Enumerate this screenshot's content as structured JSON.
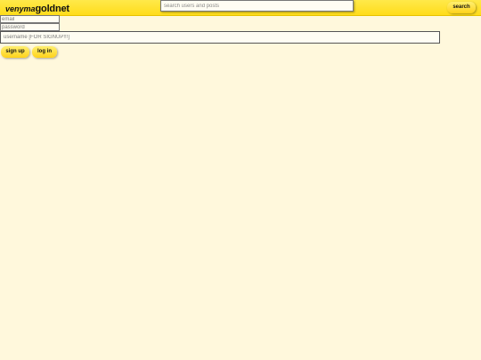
{
  "header": {
    "logo_part1": "venyma",
    "logo_part2": "goldnet",
    "search_placeholder": "search users and posts",
    "search_value": "",
    "search_button_label": "search"
  },
  "auth_form": {
    "email_placeholder": "email",
    "email_value": "",
    "password_placeholder": "password",
    "password_value": "",
    "username_placeholder": "username [FOR SIGNUP!!!]",
    "username_value": "",
    "signup_button_label": "sign up",
    "login_button_label": "log in"
  },
  "colors": {
    "page_background": "#fff8dc",
    "header_background": "#ffdc1a",
    "button_background": "#ffd21a"
  }
}
